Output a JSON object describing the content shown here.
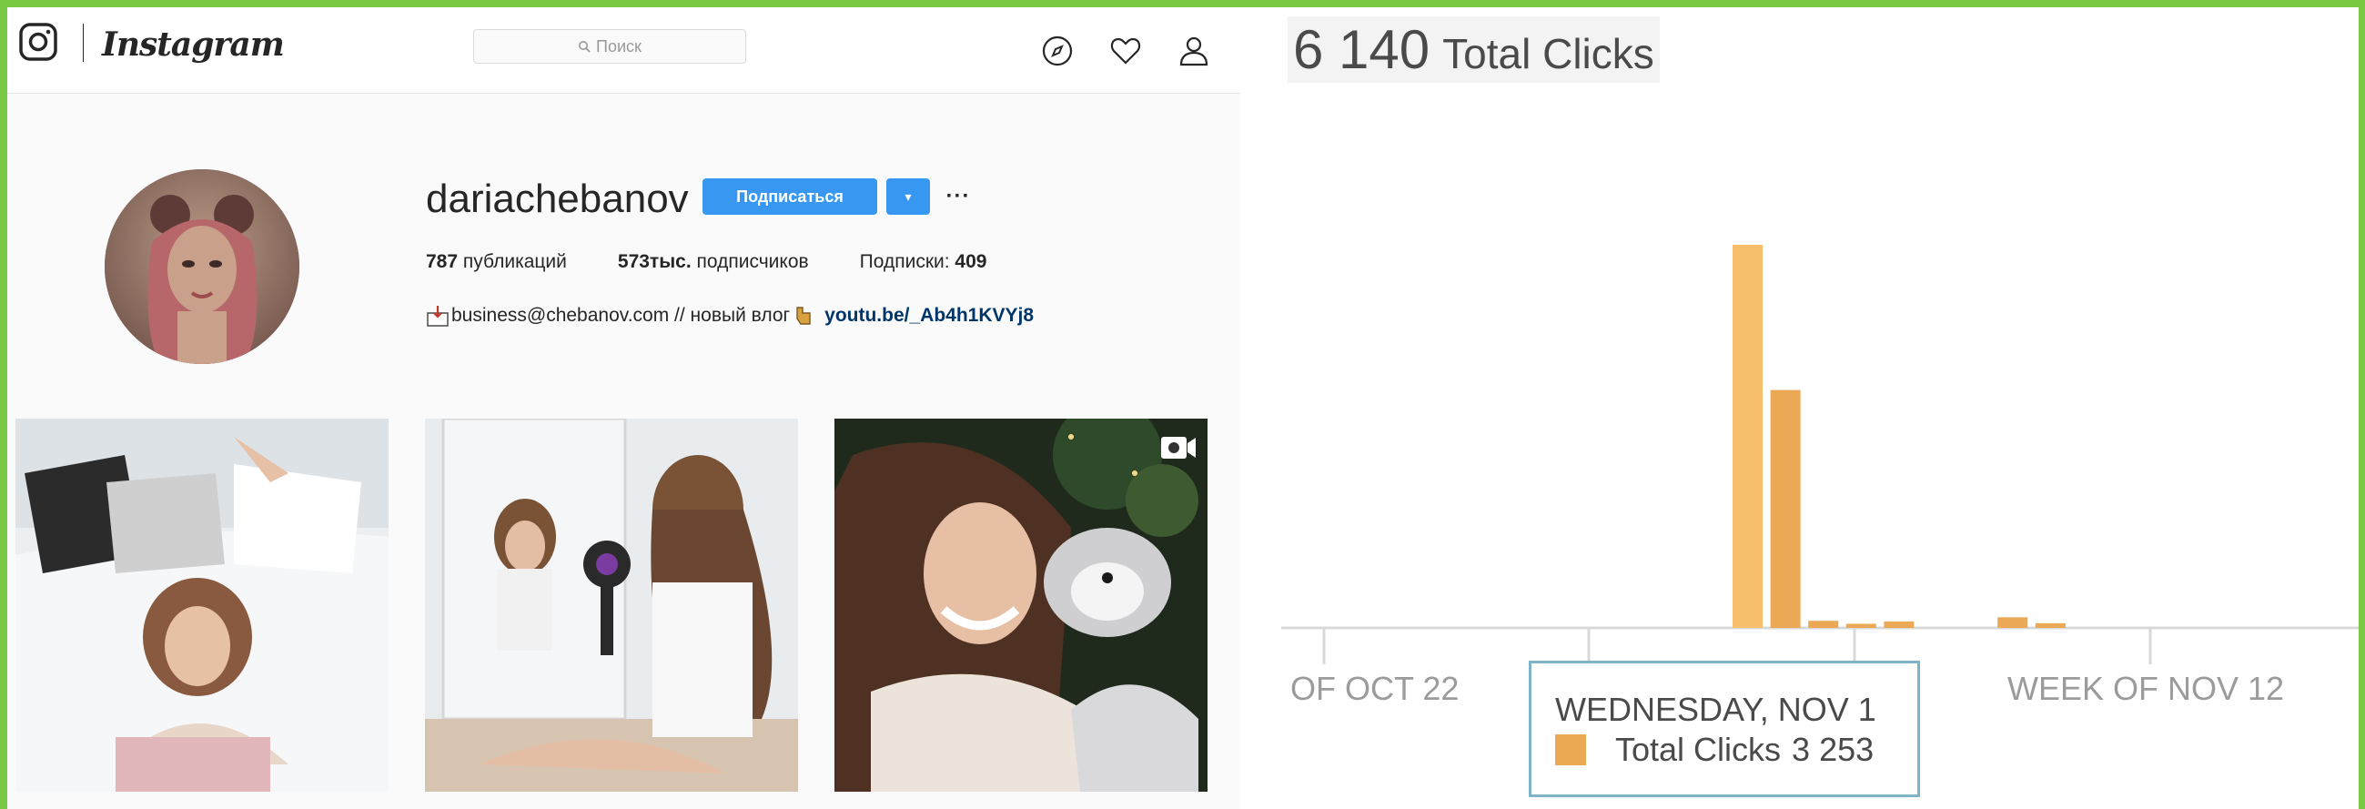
{
  "instagram": {
    "wordmark": "Instagram",
    "search": {
      "placeholder": "Поиск"
    },
    "nav_icons": [
      "compass-icon",
      "heart-icon",
      "user-icon"
    ],
    "profile": {
      "username": "dariachebanov",
      "follow_label": "Подписаться",
      "dropdown_icon": "▾",
      "more_label": "···",
      "stats": {
        "posts_count": "787",
        "posts_label": "публикаций",
        "followers_count": "573тыс.",
        "followers_label": "подписчиков",
        "following_label": "Подписки:",
        "following_count": "409"
      },
      "bio": {
        "text": "business@chebanov.com // новый влог",
        "link": "youtu.be/_Ab4h1KVYj8"
      }
    },
    "posts": [
      "post-1",
      "post-2",
      "post-3"
    ]
  },
  "analytics": {
    "total_value": "6 140",
    "total_label": "Total Clicks",
    "tooltip": {
      "title": "WEDNESDAY, NOV 1",
      "series_label": "Total Clicks",
      "value": "3 253"
    },
    "colors": {
      "bar": "#eba855",
      "bar_highlight": "#f7bf6c",
      "axis": "#d8d8d8"
    }
  },
  "chart_data": {
    "type": "bar",
    "title": "6 140 Total Clicks",
    "series": [
      {
        "name": "Total Clicks",
        "points": [
          {
            "x": "2017-10-31",
            "y": 3253
          },
          {
            "x": "2017-11-01",
            "y": 2020
          },
          {
            "x": "2017-11-02",
            "y": 60
          },
          {
            "x": "2017-11-03",
            "y": 35
          },
          {
            "x": "2017-11-04",
            "y": 55
          },
          {
            "x": "2017-11-07",
            "y": 90
          },
          {
            "x": "2017-11-08",
            "y": 40
          }
        ]
      }
    ],
    "x_tick_labels": [
      "OF OCT 22",
      "WEEK OF NOV 12"
    ],
    "ylim": [
      0,
      3400
    ]
  }
}
